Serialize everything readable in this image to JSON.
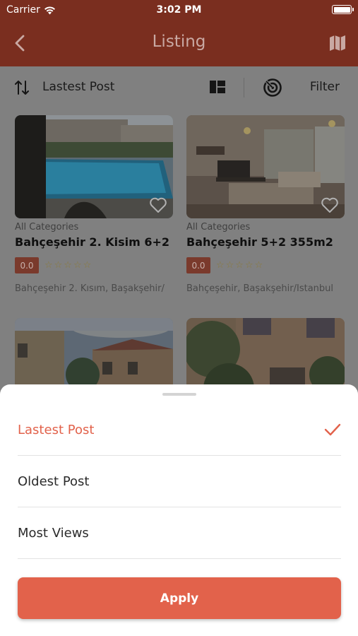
{
  "status_bar": {
    "carrier": "Carrier",
    "time": "3:02 PM"
  },
  "nav": {
    "title": "Listing",
    "back_icon": "chevron-left-icon",
    "map_icon": "map-icon"
  },
  "toolbar": {
    "sort_label": "Lastest Post",
    "filter_label": "Filter"
  },
  "listings": [
    {
      "category": "All Categories",
      "name": "Bahçeşehir 2. Kisim 6+2",
      "rating": "0.0",
      "stars": "☆☆☆☆☆",
      "address": "Bahçeşehir 2. Kısım, Başakşehir/"
    },
    {
      "category": "All Categories",
      "name": "Bahçeşehir 5+2 355m2",
      "rating": "0.0",
      "stars": "☆☆☆☆☆",
      "address": "Bahçeşehir, Başakşehir/İstanbul"
    }
  ],
  "sheet": {
    "options": [
      {
        "label": "Lastest Post",
        "selected": true
      },
      {
        "label": "Oldest Post",
        "selected": false
      },
      {
        "label": "Most Views",
        "selected": false
      }
    ],
    "apply_label": "Apply"
  },
  "colors": {
    "accent": "#e2624b",
    "nav": "#7a2e1f"
  }
}
